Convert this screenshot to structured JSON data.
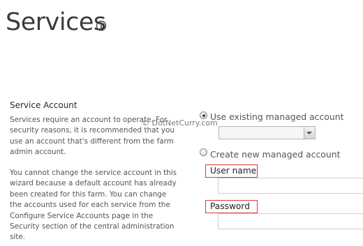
{
  "page": {
    "title": "Services",
    "watermark": "© DotNetCurry.com"
  },
  "service_account": {
    "heading": "Service Account",
    "description_1": "Services require an account to operate. For security reasons, it is recommended that you use an account that's different from the farm admin account.",
    "description_2": "You cannot change the service account in this wizard because a default account has already been created for this farm. You can change the accounts used for each service from the Configure Service Accounts page in the Security section of the central administration site."
  },
  "options": {
    "use_existing_label": "Use existing managed account",
    "use_existing_selected": true,
    "managed_account_value": "",
    "create_new_label": "Create new managed account",
    "create_new_selected": false
  },
  "fields": {
    "user_name_label": "User name",
    "user_name_value": "",
    "password_label": "Password",
    "password_value": ""
  },
  "colors": {
    "highlight_border": "#d9392f"
  }
}
